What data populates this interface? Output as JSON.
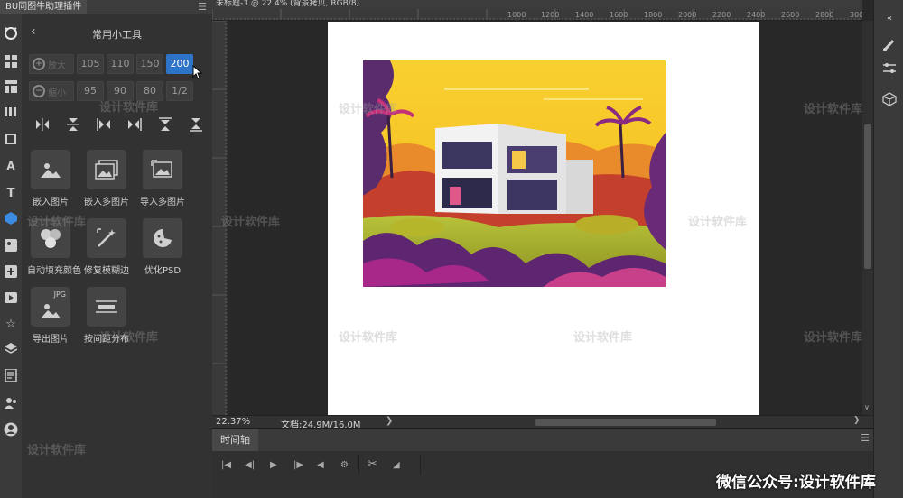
{
  "plugin": {
    "tab_label": "BU同图牛助理插件",
    "title": "常用小工具",
    "zoom_in_row": [
      "105",
      "110",
      "150",
      "200"
    ],
    "zoom_out_row": [
      "95",
      "90",
      "80",
      "1/2"
    ],
    "zoom_in_placeholder": "放大",
    "zoom_out_placeholder": "缩小",
    "active_zoom": "200",
    "tools": [
      {
        "label": "嵌入图片",
        "icon": "image-icon"
      },
      {
        "label": "嵌入多图片",
        "icon": "multi-image-icon"
      },
      {
        "label": "导入多图片",
        "icon": "import-images-icon"
      },
      {
        "label": "自动填充颜色",
        "icon": "fill-color-icon"
      },
      {
        "label": "修复模糊边",
        "icon": "fix-edge-icon"
      },
      {
        "label": "优化PSD",
        "icon": "optimize-psd-icon"
      },
      {
        "label": "导出图片",
        "icon": "export-jpg-icon"
      },
      {
        "label": "按间距分布",
        "icon": "distribute-icon"
      }
    ],
    "export_badge": "JPG"
  },
  "document": {
    "tab_text": "未标题-1 @ 22.4% (背景拷贝, RGB/8)",
    "ruler_ticks": [
      "1000",
      "1200",
      "1400",
      "1600",
      "1800",
      "2000",
      "2200",
      "2400",
      "2600",
      "2800",
      "300"
    ]
  },
  "status": {
    "zoom": "22.37%",
    "doc_info": "文档:24.9M/16.0M"
  },
  "timeline": {
    "tab_label": "时间轴"
  },
  "watermarks": {
    "repeat_text": "设计软件库",
    "brand": "微信公众号:设计软件库"
  },
  "colors": {
    "accent": "#2d73c8",
    "sky": "#f7c928"
  }
}
